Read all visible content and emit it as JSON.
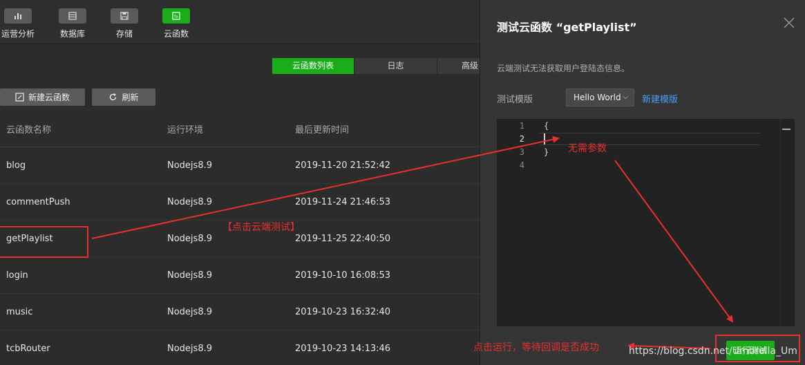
{
  "toolbar": {
    "items": [
      {
        "label": "运营分析",
        "icon": "chart-icon"
      },
      {
        "label": "数据库",
        "icon": "database-icon"
      },
      {
        "label": "存储",
        "icon": "storage-icon"
      },
      {
        "label": "云函数",
        "icon": "function-icon"
      }
    ]
  },
  "tabs": [
    {
      "label": "云函数列表"
    },
    {
      "label": "日志"
    },
    {
      "label": "高级"
    }
  ],
  "actions": {
    "new_label": "新建云函数",
    "refresh_label": "刷新"
  },
  "table": {
    "headers": [
      "云函数名称",
      "运行环境",
      "最后更新时间"
    ],
    "rows": [
      {
        "name": "blog",
        "runtime": "Nodejs8.9",
        "updated": "2019-11-20 21:52:42"
      },
      {
        "name": "commentPush",
        "runtime": "Nodejs8.9",
        "updated": "2019-11-24 21:46:53"
      },
      {
        "name": "getPlaylist",
        "runtime": "Nodejs8.9",
        "updated": "2019-11-25 22:40:50"
      },
      {
        "name": "login",
        "runtime": "Nodejs8.9",
        "updated": "2019-10-10 16:08:53"
      },
      {
        "name": "music",
        "runtime": "Nodejs8.9",
        "updated": "2019-10-23 16:32:40"
      },
      {
        "name": "tcbRouter",
        "runtime": "Nodejs8.9",
        "updated": "2019-10-23 14:13:46"
      }
    ]
  },
  "panel": {
    "title": "测试云函数 “getPlaylist”",
    "hint": "云端测试无法获取用户登陆态信息。",
    "template_label": "测试模版",
    "template_value": "Hello World",
    "new_template": "新建模版",
    "editor": {
      "line_numbers": [
        "1",
        "2",
        "3",
        "4"
      ],
      "lines": [
        "{",
        "",
        "}",
        ""
      ]
    },
    "run_label": "运行测试"
  },
  "annotations": {
    "click_cloud_test": "【点击云端测试】",
    "no_params": "无需参数",
    "run_hint": "点击运行，等待回调是否成功"
  },
  "watermark": "https://blog.csdn.net/Umbrella_Um",
  "colors": {
    "accent": "#1aad19",
    "annotation": "#e8302e",
    "link": "#4a9eff"
  }
}
